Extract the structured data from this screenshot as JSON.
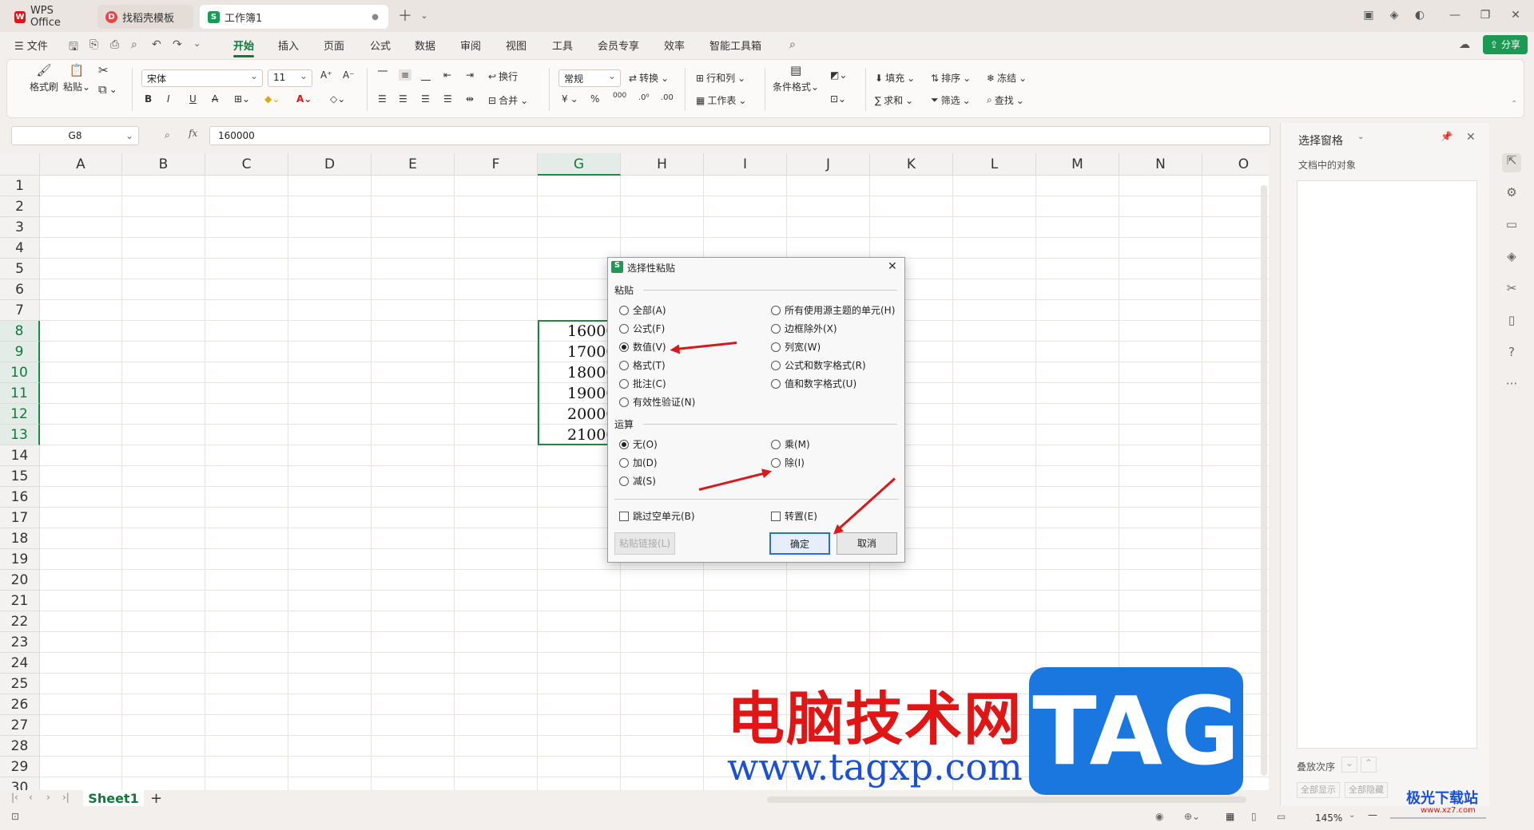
{
  "tabs": [
    {
      "label": "WPS Office",
      "icon": "wps-logo-icon",
      "color": "#d7191c"
    },
    {
      "label": "找稻壳模板",
      "icon": "docer-icon",
      "color": "#e84545"
    },
    {
      "label": "工作簿1",
      "icon": "spreadsheet-icon",
      "color": "#1a9a52"
    }
  ],
  "menu": {
    "file": "文件",
    "items": [
      "开始",
      "插入",
      "页面",
      "公式",
      "数据",
      "审阅",
      "视图",
      "工具",
      "会员专享",
      "效率",
      "智能工具箱"
    ],
    "active": "开始",
    "share": "分享"
  },
  "ribbon": {
    "format_painter": "格式刷",
    "paste": "粘贴",
    "font_name": "宋体",
    "font_size": "11",
    "wrap": "换行",
    "merge": "合并",
    "number_format": "常规",
    "convert": "转换",
    "row_col": "行和列",
    "worksheet": "工作表",
    "cond_format": "条件格式",
    "fill": "填充",
    "sort": "排序",
    "freeze": "冻结",
    "sum": "求和",
    "filter": "筛选",
    "find": "查找",
    "currency": "¥",
    "percent": "%",
    "thousands": "000"
  },
  "formula_bar": {
    "cell": "G8",
    "value": "160000"
  },
  "columns": [
    "A",
    "B",
    "C",
    "D",
    "E",
    "F",
    "G",
    "H",
    "I",
    "J",
    "K",
    "L",
    "M",
    "N",
    "O"
  ],
  "rows": [
    "1",
    "2",
    "3",
    "4",
    "5",
    "6",
    "7",
    "8",
    "9",
    "10",
    "11",
    "12",
    "13",
    "14",
    "15",
    "16",
    "17",
    "18",
    "19",
    "20",
    "21",
    "22",
    "23",
    "24",
    "25",
    "26",
    "27",
    "28",
    "29",
    "30"
  ],
  "cells": [
    "16000",
    "17000",
    "18000",
    "19000",
    "20000",
    "21000"
  ],
  "sheet_tab": "Sheet1",
  "panel": {
    "title": "选择窗格",
    "subtitle": "文档中的对象",
    "stack_order": "叠放次序",
    "show_all": "全部显示",
    "hide_all": "全部隐藏"
  },
  "dialog": {
    "title": "选择性粘贴",
    "paste_section": "粘贴",
    "paste_left": [
      "全部(A)",
      "公式(F)",
      "数值(V)",
      "格式(T)",
      "批注(C)",
      "有效性验证(N)"
    ],
    "paste_right": [
      "所有使用源主题的单元(H)",
      "边框除外(X)",
      "列宽(W)",
      "公式和数字格式(R)",
      "值和数字格式(U)"
    ],
    "paste_selected": "数值(V)",
    "op_section": "运算",
    "op_left": [
      "无(O)",
      "加(D)",
      "减(S)"
    ],
    "op_right": [
      "乘(M)",
      "除(I)"
    ],
    "op_selected": "无(O)",
    "skip_blanks": "跳过空单元(B)",
    "transpose": "转置(E)",
    "paste_link": "粘贴链接(L)",
    "ok": "确定",
    "cancel": "取消"
  },
  "status": {
    "zoom": "145%"
  },
  "watermark": {
    "title": "电脑技术网",
    "url": "www.tagxp.com",
    "tag": "TAG",
    "site": "极光下载站",
    "site_url": "www.xz7.com"
  }
}
